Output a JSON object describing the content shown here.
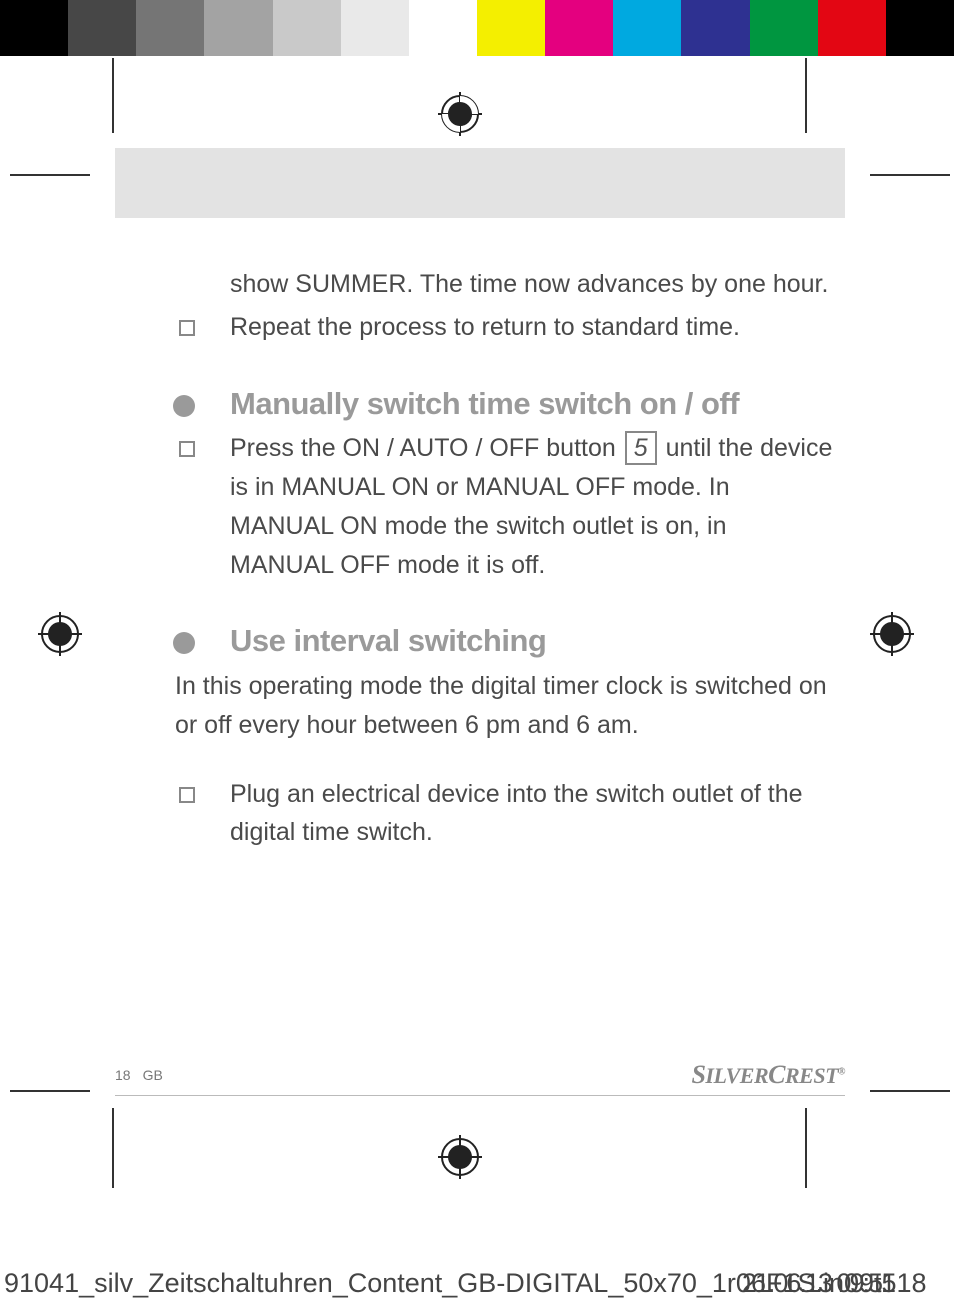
{
  "colorbar": [
    "#000000",
    "#474747",
    "#757575",
    "#a3a3a3",
    "#c9c9c9",
    "#e9e9e9",
    "#ffffff",
    "#f4ef00",
    "#e4007f",
    "#00a9e0",
    "#2e3191",
    "#009640",
    "#e30613",
    "#000000"
  ],
  "body": {
    "p1": "show SUMMER. The time now advances by one hour.",
    "item1": "Repeat the process to return to standard time.",
    "sec1_title": "Manually switch time switch on / off",
    "sec1_item_pre": "Press the ON / AUTO / OFF button ",
    "sec1_item_num": "5",
    "sec1_item_post": " until the device is in MANUAL ON or MANUAL OFF mode. In MANUAL ON mode the switch outlet is on, in MANUAL OFF mode it is off.",
    "sec2_title": "Use interval switching",
    "sec2_intro": "In this operating mode the digital timer clock is switched on or off every hour between 6 pm and 6 am.",
    "sec2_item1": "Plug an electrical device into the switch outlet of the digital time switch."
  },
  "footer": {
    "page": "18",
    "lang": "GB",
    "brand_a": "S",
    "brand_b": "ILVER",
    "brand_c": "C",
    "brand_d": "REST",
    "brand_r": "®"
  },
  "overlay": {
    "left": "91041_silv_Zeitschaltuhren_Content_GB-DIGITAL_50x70_1r06F1S.in09t518",
    "right": "21.06.13 09:51"
  }
}
